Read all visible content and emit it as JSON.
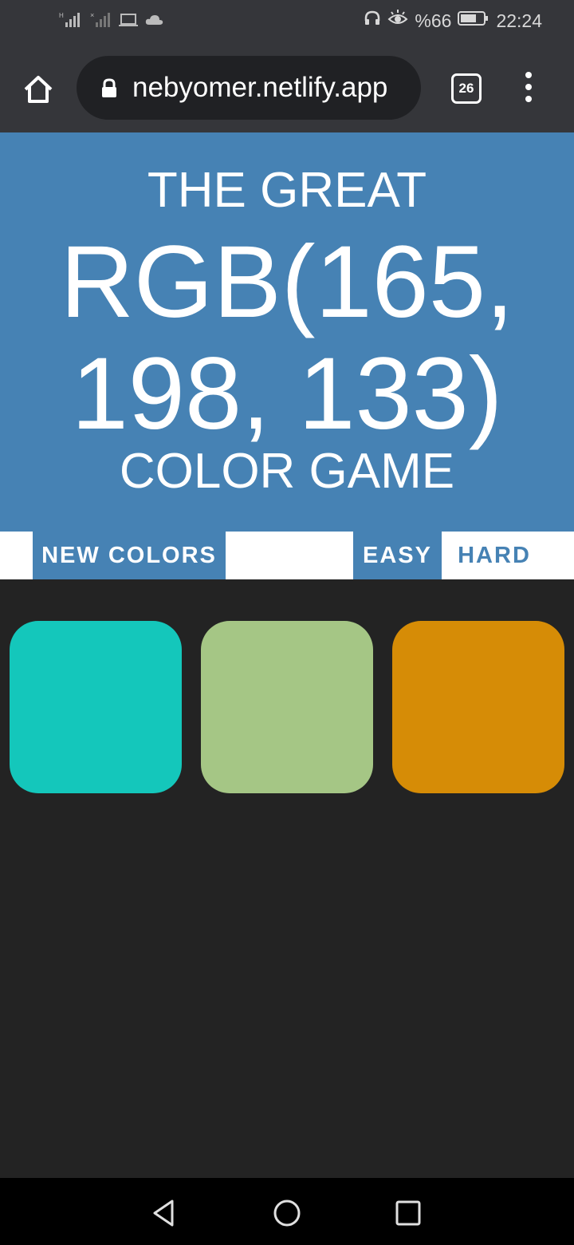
{
  "status_bar": {
    "battery": "%66",
    "time": "22:24"
  },
  "browser": {
    "url": "nebyomer.netlify.app",
    "tab_count": "26"
  },
  "game": {
    "title_top": "THE GREAT",
    "rgb_line1": "RGB(165,",
    "rgb_line2": "198, 133)",
    "title_bottom": "COLOR GAME"
  },
  "controls": {
    "new_colors": "NEW COLORS",
    "message": "",
    "easy": "EASY",
    "hard": "HARD"
  },
  "squares": [
    {
      "color": "#14c7bb"
    },
    {
      "color": "#a5c685"
    },
    {
      "color": "#d68c06"
    }
  ],
  "colors": {
    "header_bg": "#4682b4",
    "page_bg": "#232323",
    "chrome_bg": "#35363a"
  }
}
